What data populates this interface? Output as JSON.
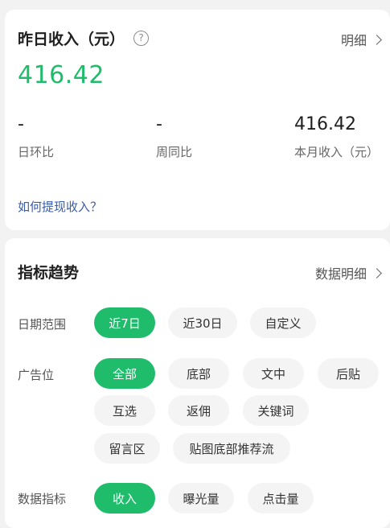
{
  "income": {
    "title": "昨日收入（元）",
    "help_glyph": "?",
    "detail_link": "明细",
    "value": "416.42",
    "stats": [
      {
        "value": "-",
        "label": "日环比"
      },
      {
        "value": "-",
        "label": "周同比"
      },
      {
        "value": "416.42",
        "label": "本月收入（元）"
      }
    ],
    "withdraw_help": "如何提现收入？"
  },
  "trend": {
    "title": "指标趋势",
    "detail_link": "数据明细",
    "date_range": {
      "label": "日期范围",
      "options": [
        "近7日",
        "近30日",
        "自定义"
      ],
      "selected": "近7日"
    },
    "ad_slot": {
      "label": "广告位",
      "options": [
        "全部",
        "底部",
        "文中",
        "后贴",
        "互选",
        "返佣",
        "关键词",
        "留言区",
        "贴图底部推荐流"
      ],
      "selected": "全部"
    },
    "metric": {
      "label": "数据指标",
      "options": [
        "收入",
        "曝光量",
        "点击量"
      ],
      "selected": "收入"
    }
  },
  "colors": {
    "accent": "#1fbd6b",
    "link": "#3a5da8",
    "background": "#f2f2f2"
  }
}
